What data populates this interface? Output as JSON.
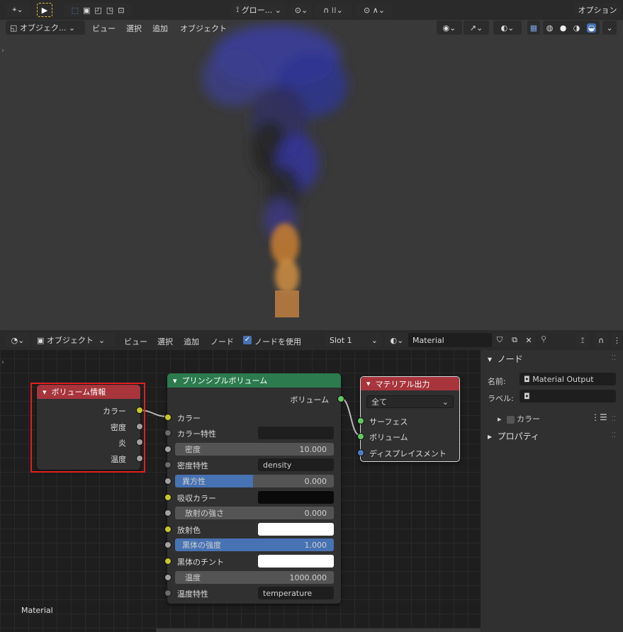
{
  "viewport": {
    "toolbar": {
      "transform_orientation": "グロー...",
      "options_label": "オプション"
    },
    "header": {
      "mode": "オブジェク...",
      "menus": [
        "ビュー",
        "選択",
        "追加",
        "オブジェクト"
      ]
    }
  },
  "node_editor": {
    "header": {
      "mode": "オブジェクト",
      "menus": [
        "ビュー",
        "選択",
        "追加",
        "ノード"
      ],
      "use_nodes_label": "ノードを使用",
      "slot": "Slot 1",
      "material_name": "Material"
    },
    "footer_label": "Material",
    "nodes": {
      "volume_info": {
        "title": "ボリューム情報",
        "outputs": [
          "カラー",
          "密度",
          "炎",
          "温度"
        ]
      },
      "principled_volume": {
        "title": "プリンシプルボリューム",
        "output": "ボリューム",
        "rows": {
          "color": "カラー",
          "color_attr": "カラー特性",
          "density_label": "密度",
          "density_value": "10.000",
          "density_attr": "密度特性",
          "density_attr_value": "density",
          "anisotropy_label": "異方性",
          "anisotropy_value": "0.000",
          "absorption_color": "吸収カラー",
          "emission_strength_label": "放射の強さ",
          "emission_strength_value": "0.000",
          "emission_color": "放射色",
          "blackbody_intensity_label": "黒体の強度",
          "blackbody_intensity_value": "1.000",
          "blackbody_tint": "黒体のチント",
          "temperature_label": "温度",
          "temperature_value": "1000.000",
          "temperature_attr": "温度特性",
          "temperature_attr_value": "temperature"
        }
      },
      "material_output": {
        "title": "マテリアル出力",
        "target": "全て",
        "inputs": [
          "サーフェス",
          "ボリューム",
          "ディスプレイスメント"
        ]
      }
    }
  },
  "sidebar": {
    "section_node": "ノード",
    "name_label": "名前:",
    "name_value": "Material Output",
    "label_label": "ラベル:",
    "color_label": "カラー",
    "properties_label": "プロパティ"
  },
  "colors": {
    "accent_blue": "#4772b3",
    "volume_info_header": "#a8343c",
    "principled_header": "#2b7b4e",
    "output_header": "#a8343c",
    "socket_yellow": "#c7c729",
    "socket_gray": "#a1a1a1",
    "socket_green": "#63c763",
    "socket_blue": "#6363c7",
    "selection_box": "#e02020"
  }
}
